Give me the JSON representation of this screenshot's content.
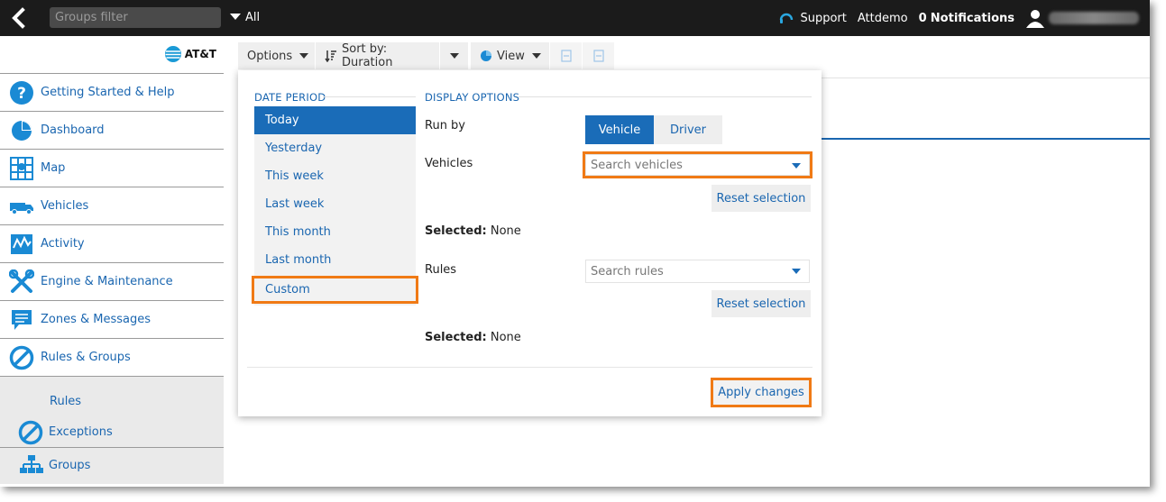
{
  "topbar": {
    "groups_filter_placeholder": "Groups filter",
    "groups_filter_value": "All",
    "support_label": "Support",
    "user_label": "Attdemo",
    "notifications_count": "0",
    "notifications_label": "Notifications"
  },
  "brand": {
    "logo_text": "AT&T",
    "accent": "#1a6cb8",
    "highlight": "#f07a15"
  },
  "sidebar": {
    "items": [
      {
        "label": "Getting Started & Help",
        "icon": "help-icon"
      },
      {
        "label": "Dashboard",
        "icon": "pie-chart-icon"
      },
      {
        "label": "Map",
        "icon": "map-icon"
      },
      {
        "label": "Vehicles",
        "icon": "truck-icon"
      },
      {
        "label": "Activity",
        "icon": "activity-icon"
      },
      {
        "label": "Engine & Maintenance",
        "icon": "wrench-icon"
      },
      {
        "label": "Zones & Messages",
        "icon": "message-icon"
      },
      {
        "label": "Rules & Groups",
        "icon": "ban-icon"
      }
    ],
    "subitems": [
      {
        "label": "Rules"
      },
      {
        "label": "Exceptions",
        "icon": "ban-icon"
      },
      {
        "label": "Groups",
        "icon": "org-chart-icon"
      }
    ]
  },
  "toolbar": {
    "options_label": "Options",
    "sort_label": "Sort by: Duration",
    "view_label": "View"
  },
  "panel": {
    "date_period_title": "DATE PERIOD",
    "date_periods": [
      "Today",
      "Yesterday",
      "This week",
      "Last week",
      "This month",
      "Last month"
    ],
    "custom_label": "Custom",
    "display_options_title": "DISPLAY OPTIONS",
    "run_by_label": "Run by",
    "run_by_options": [
      "Vehicle",
      "Driver"
    ],
    "vehicles_label": "Vehicles",
    "vehicles_placeholder": "Search vehicles",
    "reset_label": "Reset selection",
    "selected_label": "Selected:",
    "vehicles_selected": "None",
    "rules_label": "Rules",
    "rules_placeholder": "Search rules",
    "rules_selected": "None",
    "apply_label": "Apply changes"
  }
}
